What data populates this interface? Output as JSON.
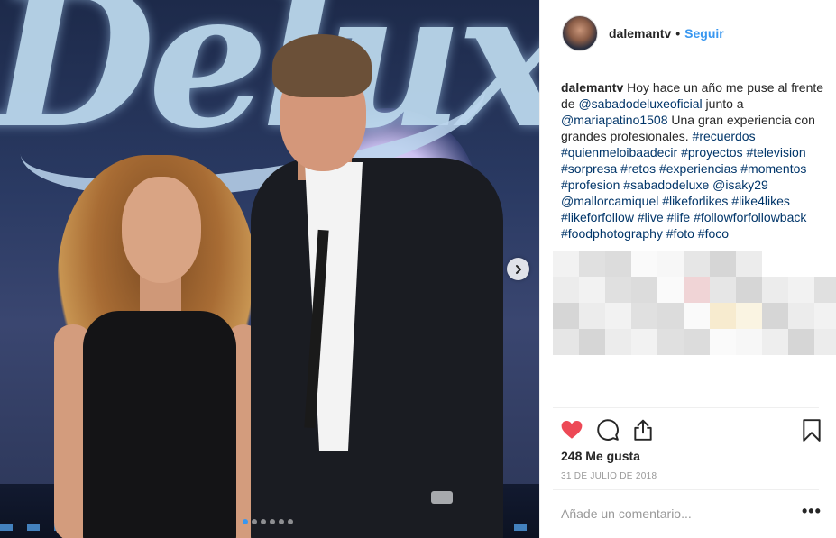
{
  "post": {
    "username": "dalemantv",
    "separator": "•",
    "follow_label": "Seguir",
    "caption": {
      "author": "dalemantv",
      "segments": [
        {
          "text": " Hoy hace un año me puse al frente de ",
          "kind": "text"
        },
        {
          "text": "@sabadodeluxeoficial",
          "kind": "tag"
        },
        {
          "text": " junto a ",
          "kind": "text"
        },
        {
          "text": "@mariapatino1508",
          "kind": "tag"
        },
        {
          "text": " Una gran experiencia con grandes profesionales. ",
          "kind": "text"
        },
        {
          "text": "#recuerdos",
          "kind": "tag"
        },
        {
          "text": " ",
          "kind": "text"
        },
        {
          "text": "#quienmeloibaadecir",
          "kind": "tag"
        },
        {
          "text": " ",
          "kind": "text"
        },
        {
          "text": "#proyectos",
          "kind": "tag"
        },
        {
          "text": " ",
          "kind": "text"
        },
        {
          "text": "#television",
          "kind": "tag"
        },
        {
          "text": " ",
          "kind": "text"
        },
        {
          "text": "#sorpresa",
          "kind": "tag"
        },
        {
          "text": " ",
          "kind": "text"
        },
        {
          "text": "#retos",
          "kind": "tag"
        },
        {
          "text": " ",
          "kind": "text"
        },
        {
          "text": "#experiencias",
          "kind": "tag"
        },
        {
          "text": " ",
          "kind": "text"
        },
        {
          "text": "#momentos",
          "kind": "tag"
        },
        {
          "text": " ",
          "kind": "text"
        },
        {
          "text": "#profesion",
          "kind": "tag"
        },
        {
          "text": " ",
          "kind": "text"
        },
        {
          "text": "#sabadodeluxe",
          "kind": "tag"
        },
        {
          "text": " ",
          "kind": "text"
        },
        {
          "text": "@isaky29",
          "kind": "tag"
        },
        {
          "text": " ",
          "kind": "text"
        },
        {
          "text": "@mallorcamiquel",
          "kind": "tag"
        },
        {
          "text": " ",
          "kind": "text"
        },
        {
          "text": "#likeforlikes",
          "kind": "tag"
        },
        {
          "text": " ",
          "kind": "text"
        },
        {
          "text": "#like4likes",
          "kind": "tag"
        },
        {
          "text": " ",
          "kind": "text"
        },
        {
          "text": "#likeforfollow",
          "kind": "tag"
        },
        {
          "text": " ",
          "kind": "text"
        },
        {
          "text": "#live",
          "kind": "tag"
        },
        {
          "text": " ",
          "kind": "text"
        },
        {
          "text": "#life",
          "kind": "tag"
        },
        {
          "text": " ",
          "kind": "text"
        },
        {
          "text": "#followforfollowback",
          "kind": "tag"
        },
        {
          "text": " ",
          "kind": "text"
        },
        {
          "text": "#foodphotography",
          "kind": "tag"
        },
        {
          "text": " ",
          "kind": "text"
        },
        {
          "text": "#foto",
          "kind": "tag"
        },
        {
          "text": " ",
          "kind": "text"
        },
        {
          "text": "#foco",
          "kind": "tag"
        }
      ]
    },
    "likes_label": "248 Me gusta",
    "date": "31 DE JULIO DE 2018",
    "comment_placeholder": "Añade un comentario...",
    "more_label": "•••",
    "photo_text": "Deluxe",
    "carousel": {
      "count": 6,
      "active": 0
    },
    "liked": true
  },
  "icons": {
    "like": "heart-icon",
    "comment": "comment-icon",
    "share": "share-icon",
    "save": "bookmark-icon",
    "next": "chevron-right-icon"
  },
  "colors": {
    "link": "#003569",
    "follow": "#3897f0",
    "like_active": "#ed4956",
    "muted": "#999999",
    "border": "#efefef"
  }
}
